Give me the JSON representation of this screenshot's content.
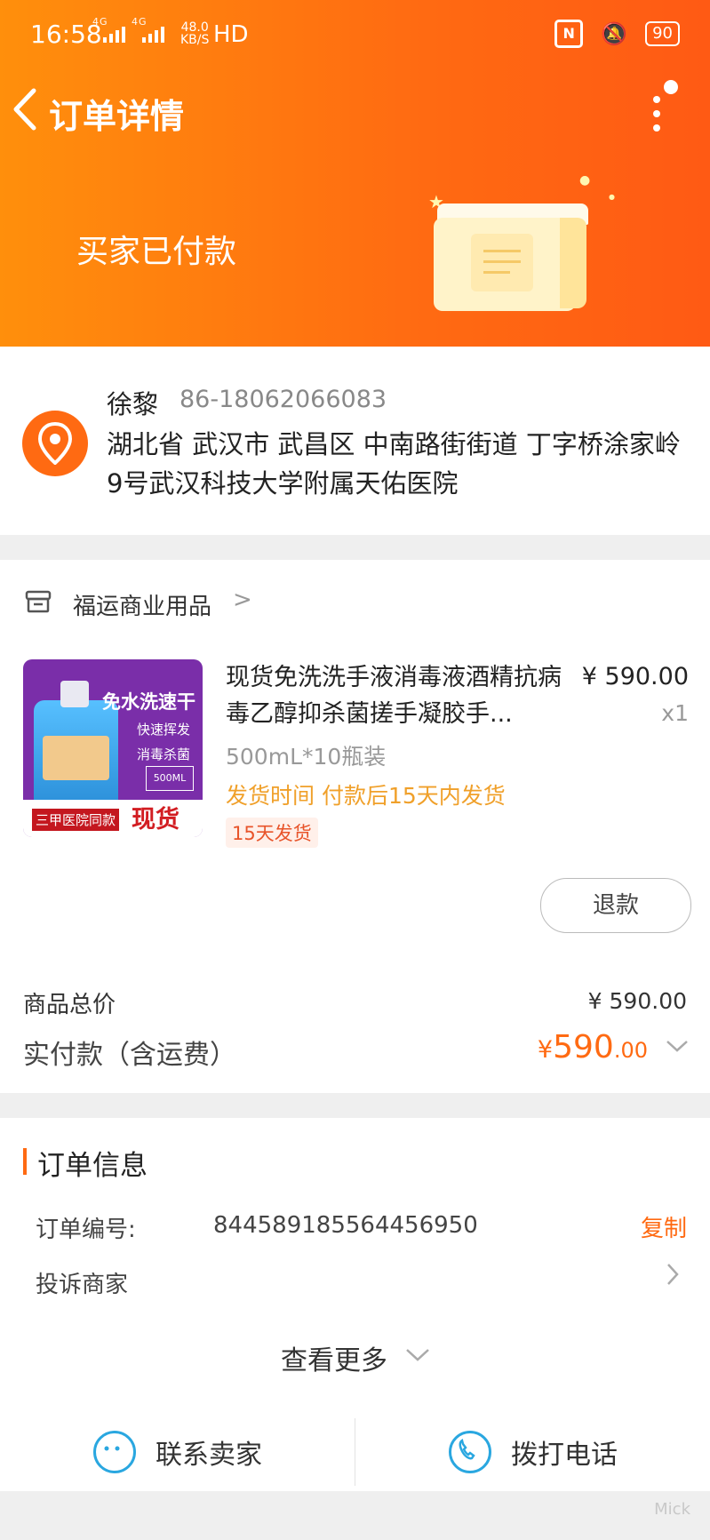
{
  "statusbar": {
    "time": "16:58",
    "net1": "4G",
    "net2": "4G",
    "speed_top": "48.0",
    "speed_bottom": "KB/S",
    "hd": "HD",
    "nfc": "N",
    "battery": "90"
  },
  "nav": {
    "back": "<",
    "title": "订单详情"
  },
  "order_status": "买家已付款",
  "address": {
    "name": "徐黎",
    "phone": "86-18062066083",
    "line": "湖北省 武汉市 武昌区 中南路街街道 丁字桥涂家岭9号武汉科技大学附属天佑医院"
  },
  "shop": {
    "name": "福运商业用品",
    "arrow": ">"
  },
  "product": {
    "image_headline": "免水洗速干",
    "image_line1": "快速挥发",
    "image_line2": "消毒杀菌",
    "image_volume": "500ML",
    "image_tag": "三甲医院同款",
    "image_stock": "现货",
    "title": "现货免洗洗手液消毒液酒精抗病毒乙醇抑杀菌搓手凝胶手...",
    "price": "¥ 590.00",
    "qty": "x1",
    "spec": "500mL*10瓶装",
    "ship_note": "发货时间 付款后15天内发货",
    "tag": "15天发货",
    "refund": "退款"
  },
  "totals": {
    "goods_label": "商品总价",
    "goods_value": "¥ 590.00",
    "paid_label": "实付款（含运费）",
    "paid_currency": "¥",
    "paid_int": "590",
    "paid_dec": ".00"
  },
  "order_info": {
    "title": "订单信息",
    "number_label": "订单编号:",
    "number_value": "844589185564456950",
    "copy": "复制",
    "complain": "投诉商家",
    "see_more": "查看更多"
  },
  "actions": {
    "contact_seller": "联系卖家",
    "call_phone": "拨打电话"
  },
  "watermark": "Mick",
  "colors": {
    "accent": "#ff6a12",
    "header_start": "#ff8f0c",
    "icon_blue": "#2aa7e0"
  }
}
